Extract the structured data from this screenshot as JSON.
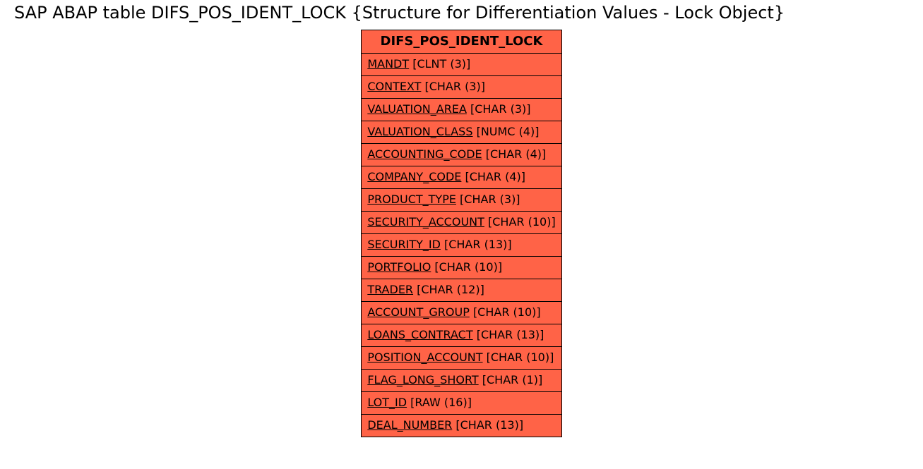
{
  "title": "SAP ABAP table DIFS_POS_IDENT_LOCK {Structure for Differentiation Values - Lock Object}",
  "table_name": "DIFS_POS_IDENT_LOCK",
  "fields": [
    {
      "name": "MANDT",
      "type": "[CLNT (3)]"
    },
    {
      "name": "CONTEXT",
      "type": "[CHAR (3)]"
    },
    {
      "name": "VALUATION_AREA",
      "type": "[CHAR (3)]"
    },
    {
      "name": "VALUATION_CLASS",
      "type": "[NUMC (4)]"
    },
    {
      "name": "ACCOUNTING_CODE",
      "type": "[CHAR (4)]"
    },
    {
      "name": "COMPANY_CODE",
      "type": "[CHAR (4)]"
    },
    {
      "name": "PRODUCT_TYPE",
      "type": "[CHAR (3)]"
    },
    {
      "name": "SECURITY_ACCOUNT",
      "type": "[CHAR (10)]"
    },
    {
      "name": "SECURITY_ID",
      "type": "[CHAR (13)]"
    },
    {
      "name": "PORTFOLIO",
      "type": "[CHAR (10)]"
    },
    {
      "name": "TRADER",
      "type": "[CHAR (12)]"
    },
    {
      "name": "ACCOUNT_GROUP",
      "type": "[CHAR (10)]"
    },
    {
      "name": "LOANS_CONTRACT",
      "type": "[CHAR (13)]"
    },
    {
      "name": "POSITION_ACCOUNT",
      "type": "[CHAR (10)]"
    },
    {
      "name": "FLAG_LONG_SHORT",
      "type": "[CHAR (1)]"
    },
    {
      "name": "LOT_ID",
      "type": "[RAW (16)]"
    },
    {
      "name": "DEAL_NUMBER",
      "type": "[CHAR (13)]"
    }
  ]
}
